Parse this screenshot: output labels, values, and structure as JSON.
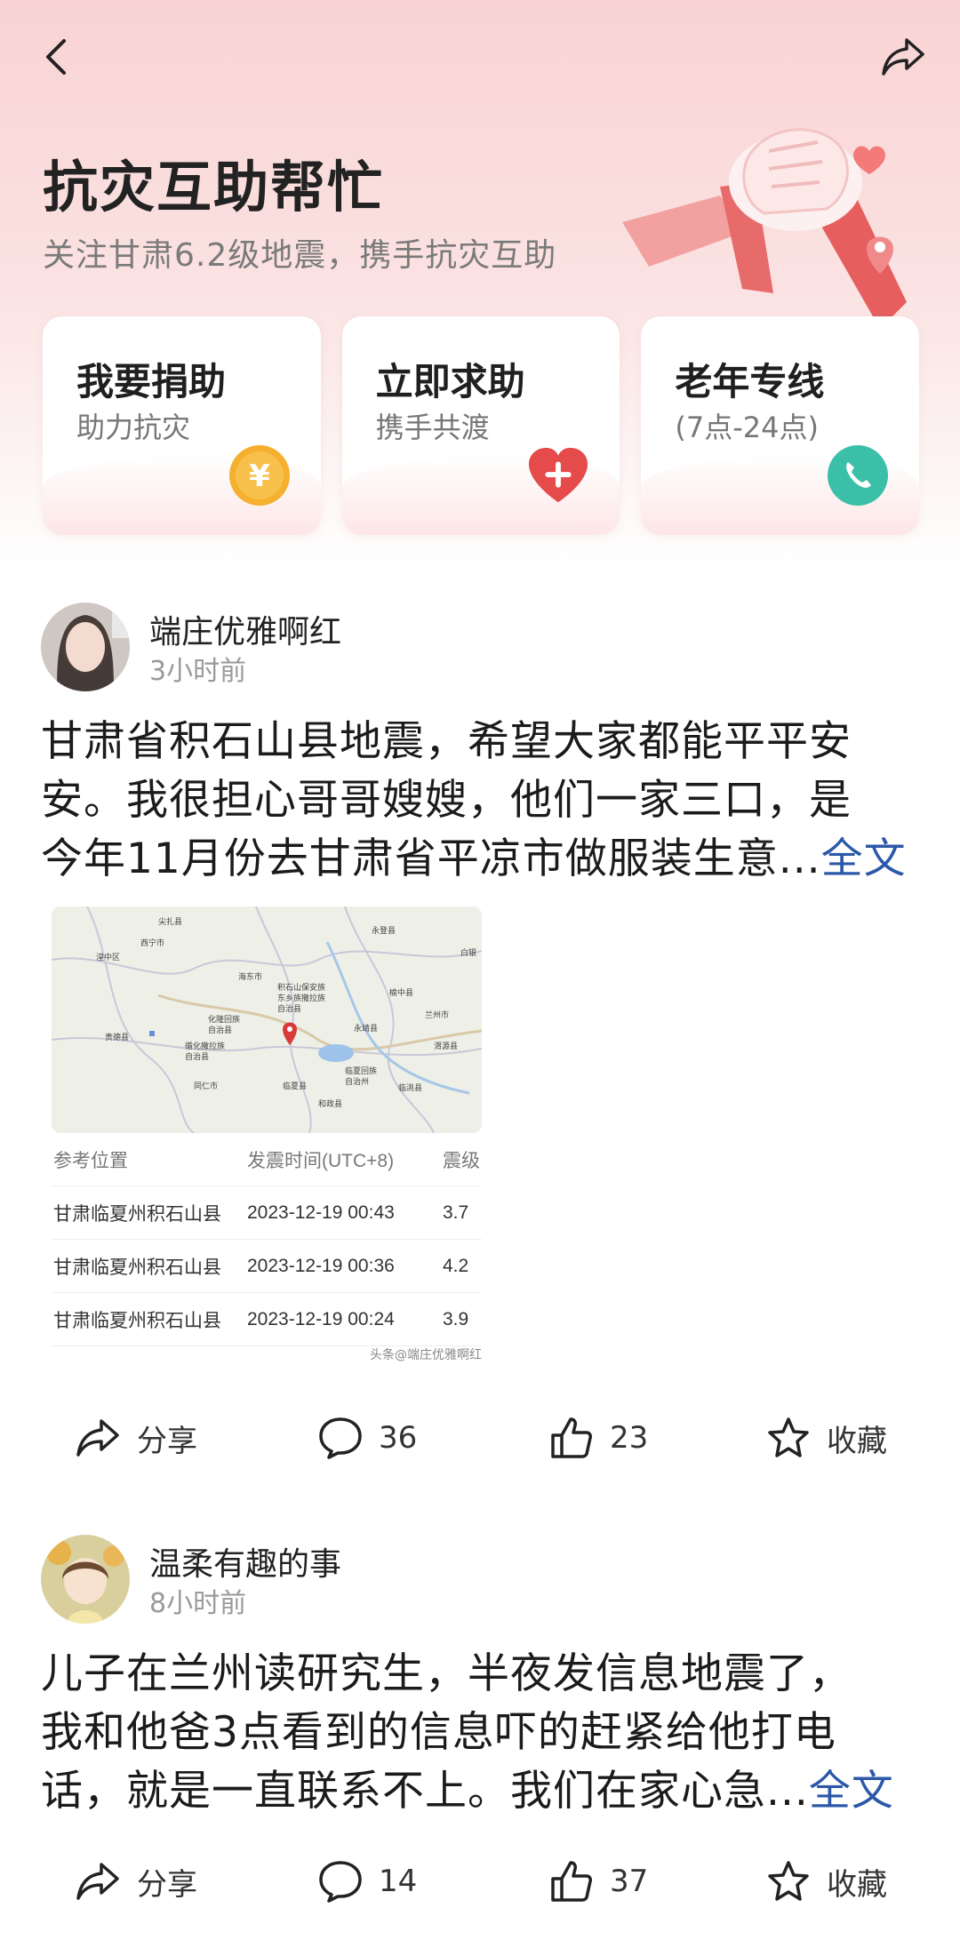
{
  "header": {
    "title": "抗灾互助帮忙",
    "subtitle": "关注甘肃6.2级地震，携手抗灾互助"
  },
  "cards": [
    {
      "title": "我要捐助",
      "subtitle": "助力抗灾",
      "icon": "yen-coin-icon",
      "color": "#f4b02e"
    },
    {
      "title": "立即求助",
      "subtitle": "携手共渡",
      "icon": "heart-plus-icon",
      "color": "#e54b4b"
    },
    {
      "title": "老年专线",
      "subtitle": "(7点-24点)",
      "icon": "phone-icon",
      "color": "#3cbfa8"
    }
  ],
  "posts": [
    {
      "author": "端庄优雅啊红",
      "time": "3小时前",
      "lines": [
        "甘肃省积石山县地震，希望大家都能平平安",
        "安。我很担心哥哥嫂嫂，他们一家三口，是",
        "今年11月份去甘肃省平凉市做服装生意..."
      ],
      "more": "全文",
      "image": {
        "map_labels": [
          "西宁市",
          "海东市",
          "临夏回族自治州",
          "兰州市",
          "永靖县",
          "同仁市",
          "临夏县",
          "化隆回族自治县",
          "循化撒拉族自治县",
          "积石山保安族东乡族撒拉族自治县",
          "贵德县",
          "白银",
          "渭源县",
          "尖扎县",
          "临洮县",
          "湟中区",
          "和政县",
          "榆中县"
        ],
        "headers": [
          "参考位置",
          "发震时间(UTC+8)",
          "震级"
        ],
        "rows": [
          [
            "甘肃临夏州积石山县",
            "2023-12-19 00:43",
            "3.7"
          ],
          [
            "甘肃临夏州积石山县",
            "2023-12-19 00:36",
            "4.2"
          ],
          [
            "甘肃临夏州积石山县",
            "2023-12-19 00:24",
            "3.9"
          ]
        ],
        "watermark": "头条@端庄优雅啊红"
      },
      "actions": {
        "share": "分享",
        "comments": "36",
        "likes": "23",
        "favorite": "收藏"
      }
    },
    {
      "author": "温柔有趣的事",
      "time": "8小时前",
      "lines": [
        "儿子在兰州读研究生，半夜发信息地震了，",
        "我和他爸3点看到的信息吓的赶紧给他打电",
        "话，就是一直联系不上。我们在家心急..."
      ],
      "more": "全文",
      "actions": {
        "share": "分享",
        "comments": "14",
        "likes": "37",
        "favorite": "收藏"
      }
    }
  ]
}
